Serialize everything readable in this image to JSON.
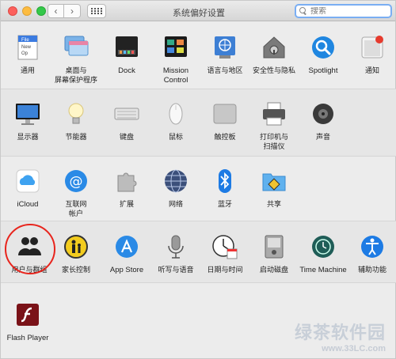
{
  "window": {
    "title": "系统偏好设置"
  },
  "toolbar": {
    "back": "‹",
    "forward": "›"
  },
  "search": {
    "placeholder": "搜索"
  },
  "rows": [
    {
      "items": [
        {
          "label": "通用",
          "icon": "general-icon"
        },
        {
          "label": "桌面与\n屏幕保护程序",
          "icon": "desktop-screensaver-icon"
        },
        {
          "label": "Dock",
          "icon": "dock-icon"
        },
        {
          "label": "Mission\nControl",
          "icon": "mission-control-icon"
        },
        {
          "label": "语言与地区",
          "icon": "language-region-icon"
        },
        {
          "label": "安全性与隐私",
          "icon": "security-privacy-icon"
        },
        {
          "label": "Spotlight",
          "icon": "spotlight-icon"
        },
        {
          "label": "通知",
          "icon": "notifications-icon"
        }
      ]
    },
    {
      "items": [
        {
          "label": "显示器",
          "icon": "displays-icon"
        },
        {
          "label": "节能器",
          "icon": "energy-saver-icon"
        },
        {
          "label": "键盘",
          "icon": "keyboard-icon"
        },
        {
          "label": "鼠标",
          "icon": "mouse-icon"
        },
        {
          "label": "触控板",
          "icon": "trackpad-icon"
        },
        {
          "label": "打印机与\n扫描仪",
          "icon": "printers-scanners-icon"
        },
        {
          "label": "声音",
          "icon": "sound-icon"
        }
      ]
    },
    {
      "items": [
        {
          "label": "iCloud",
          "icon": "icloud-icon"
        },
        {
          "label": "互联网\n帐户",
          "icon": "internet-accounts-icon"
        },
        {
          "label": "扩展",
          "icon": "extensions-icon"
        },
        {
          "label": "网络",
          "icon": "network-icon"
        },
        {
          "label": "蓝牙",
          "icon": "bluetooth-icon"
        },
        {
          "label": "共享",
          "icon": "sharing-icon"
        }
      ]
    },
    {
      "items": [
        {
          "label": "用户与群组",
          "icon": "users-groups-icon"
        },
        {
          "label": "家长控制",
          "icon": "parental-controls-icon"
        },
        {
          "label": "App Store",
          "icon": "app-store-icon"
        },
        {
          "label": "听写与语音",
          "icon": "dictation-speech-icon"
        },
        {
          "label": "日期与时间",
          "icon": "date-time-icon"
        },
        {
          "label": "启动磁盘",
          "icon": "startup-disk-icon"
        },
        {
          "label": "Time Machine",
          "icon": "time-machine-icon"
        },
        {
          "label": "辅助功能",
          "icon": "accessibility-icon"
        }
      ]
    },
    {
      "items": [
        {
          "label": "Flash Player",
          "icon": "flash-player-icon"
        }
      ]
    }
  ],
  "icon_glyphs": {
    "general": "File\nNew\nOp"
  },
  "watermark": {
    "line1": "绿茶软件园",
    "line2": "www.33LC.com"
  },
  "colors": {
    "annotation": "#e8241c",
    "search_focus": "#7aaef3"
  }
}
